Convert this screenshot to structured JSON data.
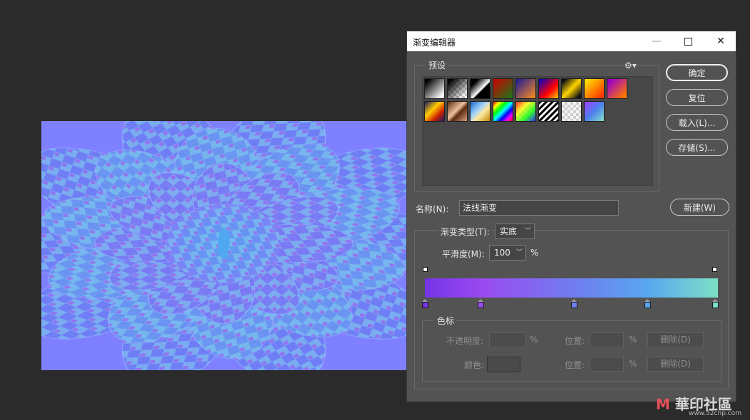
{
  "dialog": {
    "title": "渐变编辑器",
    "buttons": {
      "ok": "确定",
      "reset": "复位",
      "load": "载入(L)...",
      "save": "存储(S)...",
      "new": "新建(W)"
    },
    "presets_label": "预设",
    "name_label": "名称(N):",
    "name_value": "法线渐变",
    "gradient_type_label": "渐变类型(T):",
    "gradient_type_value": "实底",
    "smoothness_label": "平滑度(M):",
    "smoothness_value": "100",
    "percent": "%",
    "color_stop_group": "色标",
    "opacity_label": "不透明度:",
    "position_label": "位置:",
    "delete_label": "删除(D)",
    "color_label": "颜色:"
  },
  "gradient": {
    "stops": [
      {
        "pos": 0,
        "color": "#7433e6"
      },
      {
        "pos": 19,
        "color": "#9a4bf0"
      },
      {
        "pos": 51,
        "color": "#6f7ff0"
      },
      {
        "pos": 76,
        "color": "#58a6ef"
      },
      {
        "pos": 100,
        "color": "#7de0c6"
      }
    ]
  },
  "colors": {
    "canvas_bg": "#7f80ff",
    "dialog_bg": "#535353",
    "app_bg": "#2b2b2b"
  },
  "watermark": {
    "text": "華印社區",
    "url": "www.52cnp.com"
  }
}
